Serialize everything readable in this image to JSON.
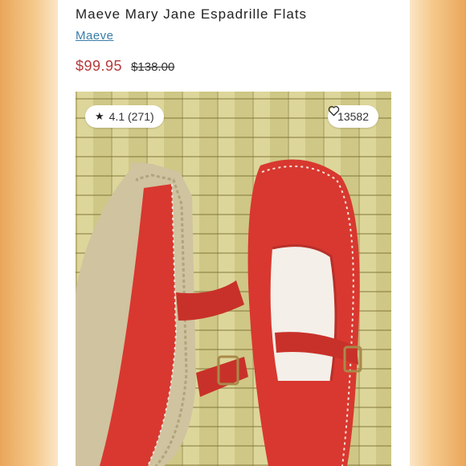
{
  "product": {
    "title": "Maeve Mary Jane Espadrille Flats",
    "brand": "Maeve",
    "price": "$99.95",
    "original_price": "$138.00"
  },
  "photo": {
    "rating_star": "★",
    "rating_text": "4.1 (271)",
    "likes_count": "13582",
    "heart_icon": "heart-outline-icon"
  },
  "colors": {
    "sale_price": "#b53a3a",
    "brand_link": "#3a7ea8",
    "shoe_red": "#d8382f",
    "frame_orange": "#e9a65a"
  }
}
